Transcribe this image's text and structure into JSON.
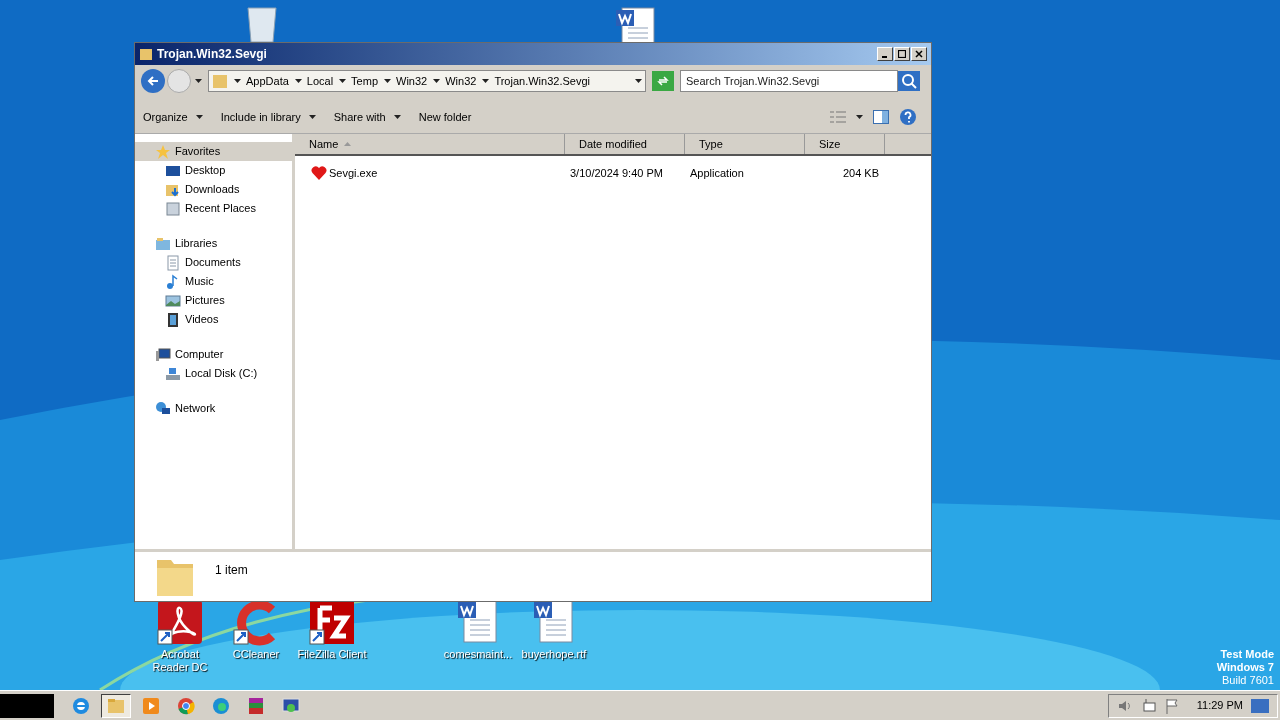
{
  "window": {
    "title": "Trojan.Win32.Sevgi"
  },
  "address": {
    "crumbs": [
      "AppData",
      "Local",
      "Temp",
      "Win32",
      "Win32",
      "Trojan.Win32.Sevgi"
    ]
  },
  "search": {
    "placeholder": "Search Trojan.Win32.Sevgi"
  },
  "toolbar": [
    {
      "label": "Organize",
      "dropdown": true
    },
    {
      "label": "Include in library",
      "dropdown": true
    },
    {
      "label": "Share with",
      "dropdown": true
    },
    {
      "label": "New folder",
      "dropdown": false
    }
  ],
  "sidebar": [
    {
      "label": "Favorites",
      "kind": "star",
      "selected": true,
      "children": [
        {
          "label": "Desktop",
          "kind": "desktop"
        },
        {
          "label": "Downloads",
          "kind": "downloads"
        },
        {
          "label": "Recent Places",
          "kind": "recent"
        }
      ]
    },
    {
      "label": "Libraries",
      "kind": "library",
      "selected": false,
      "children": [
        {
          "label": "Documents",
          "kind": "document"
        },
        {
          "label": "Music",
          "kind": "music"
        },
        {
          "label": "Pictures",
          "kind": "pictures"
        },
        {
          "label": "Videos",
          "kind": "videos"
        }
      ]
    },
    {
      "label": "Computer",
      "kind": "computer",
      "selected": false,
      "children": [
        {
          "label": "Local Disk (C:)",
          "kind": "disk"
        }
      ]
    },
    {
      "label": "Network",
      "kind": "network",
      "selected": false
    }
  ],
  "table": {
    "columns": [
      {
        "label": "Name",
        "sorted": true
      },
      {
        "label": "Date modified",
        "sorted": false
      },
      {
        "label": "Type",
        "sorted": false
      },
      {
        "label": "Size",
        "sorted": false
      }
    ],
    "rows": [
      {
        "name": "Sevgi.exe",
        "date": "3/10/2024 9:40 PM",
        "type": "Application",
        "size": "204 KB"
      }
    ]
  },
  "status": {
    "text": "1 item"
  },
  "desktop_icons": [
    {
      "label": "Acrobat Reader DC",
      "kind": "acrobat"
    },
    {
      "label": "CCleaner",
      "kind": "ccleaner"
    },
    {
      "label": "FileZilla Client",
      "kind": "filezilla"
    },
    {
      "label": "comesmaint...",
      "kind": "word"
    },
    {
      "label": "buyerhope.rtf",
      "kind": "word"
    }
  ],
  "desktop_notice": [
    "Test Mode",
    "Windows 7",
    "Build 7601"
  ],
  "taskbar": {
    "apps": [
      {
        "kind": "ie",
        "selected": false
      },
      {
        "kind": "explorer",
        "selected": true
      },
      {
        "kind": "media",
        "selected": false
      },
      {
        "kind": "chrome",
        "selected": false
      },
      {
        "kind": "edge",
        "selected": false
      },
      {
        "kind": "winrar",
        "selected": false
      },
      {
        "kind": "monitor",
        "selected": false
      }
    ],
    "time": "11:29 PM"
  }
}
